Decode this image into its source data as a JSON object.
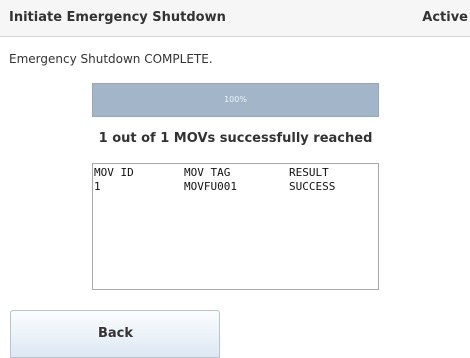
{
  "header": {
    "title": "Initiate Emergency Shutdown",
    "status": "Active"
  },
  "message": "Emergency Shutdown COMPLETE.",
  "progress": {
    "value": 1.0,
    "label": "100%"
  },
  "summary": "1 out of 1 MOVs successfully reached",
  "results": {
    "columns": [
      "MOV ID",
      "MOV TAG",
      "RESULT"
    ],
    "rows": [
      [
        "1",
        "MOVFU001",
        "SUCCESS"
      ]
    ]
  },
  "buttons": {
    "back_label": "Back"
  },
  "colors": {
    "progress_fill": "#a3b5c9",
    "button_top": "#fbfdff",
    "button_bottom": "#dde8f3"
  }
}
